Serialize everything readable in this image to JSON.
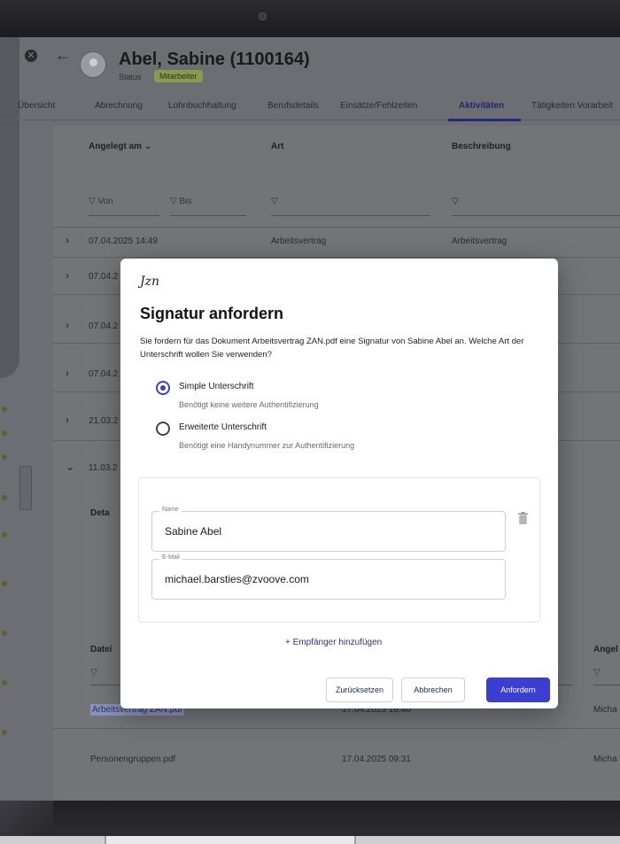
{
  "header": {
    "name": "Abel, Sabine (1100164)",
    "status_label": "Status",
    "status_badge": "Mitarbeiter"
  },
  "tabs": [
    {
      "label": "Übersicht"
    },
    {
      "label": "Abrechnung"
    },
    {
      "label": "Lohnbuchhaltung"
    },
    {
      "label": "Berufsdetails"
    },
    {
      "label": "Einsätze/Fehlzeiten"
    },
    {
      "label": "Aktivitäten",
      "active": true
    },
    {
      "label": "Tätigkeiten Vorarbeit"
    }
  ],
  "activities_table": {
    "columns": [
      "Angelegt am ⌄",
      "Art",
      "Beschreibung"
    ],
    "filters": {
      "from": "Von",
      "to": "Bis",
      "art": "▽",
      "beschreibung": "▽"
    },
    "rows": [
      {
        "chevron": "›",
        "date": "07.04.2025 14:49",
        "art": "Arbeitsvertrag",
        "beschreibung": "Arbeitsvertrag"
      },
      {
        "chevron": "›",
        "date": "07.04.2",
        "art": "",
        "beschreibung": ""
      },
      {
        "chevron": "›",
        "date": "07.04.2",
        "art": "",
        "beschreibung": ""
      },
      {
        "chevron": "›",
        "date": "07.04.2",
        "art": "",
        "beschreibung": ""
      },
      {
        "chevron": "›",
        "date": "21.03.2",
        "art": "",
        "beschreibung": ""
      },
      {
        "chevron": "⌄",
        "date": "11.03.2",
        "art": "",
        "beschreibung": ""
      }
    ],
    "detail_label": "Deta"
  },
  "documents_table": {
    "columns": [
      "Datei",
      "Angel"
    ],
    "filters": [
      "▽",
      "▽",
      "▽"
    ],
    "rows": [
      {
        "file": "Arbeitsvertrag ZAN.pdf",
        "date": "17.04.2025 16:40",
        "by": "Micha"
      },
      {
        "file": "Personengruppen.pdf",
        "date": "17.04.2025 09:31",
        "by": "Micha"
      }
    ]
  },
  "modal": {
    "logo": "Jzn",
    "title": "Signatur anfordern",
    "description": "Sie fordern für das Dokument Arbeitsvertrag ZAN.pdf eine Signatur von Sabine Abel an. Welche Art der Unterschrift wollen Sie verwenden?",
    "options": [
      {
        "label": "Simple Unterschrift",
        "hint": "Benötigt keine weitere Authentifizierung",
        "selected": true
      },
      {
        "label": "Erweiterte Unterschrift",
        "hint": "Benötigt eine Handynummer zur Authentifizierung",
        "selected": false
      }
    ],
    "recipient": {
      "name_label": "Name",
      "name_value": "Sabine Abel",
      "email_label": "E-Mail",
      "email_value": "michael.barsties@zvoove.com"
    },
    "add_recipient": "+ Empfänger hinzufügen",
    "buttons": {
      "reset": "Zurücksetzen",
      "cancel": "Abbrechen",
      "submit": "Anfordern"
    }
  },
  "colors": {
    "primary": "#3b3fd1",
    "badge": "#8a9a4e",
    "active_tab": "#202c78"
  }
}
